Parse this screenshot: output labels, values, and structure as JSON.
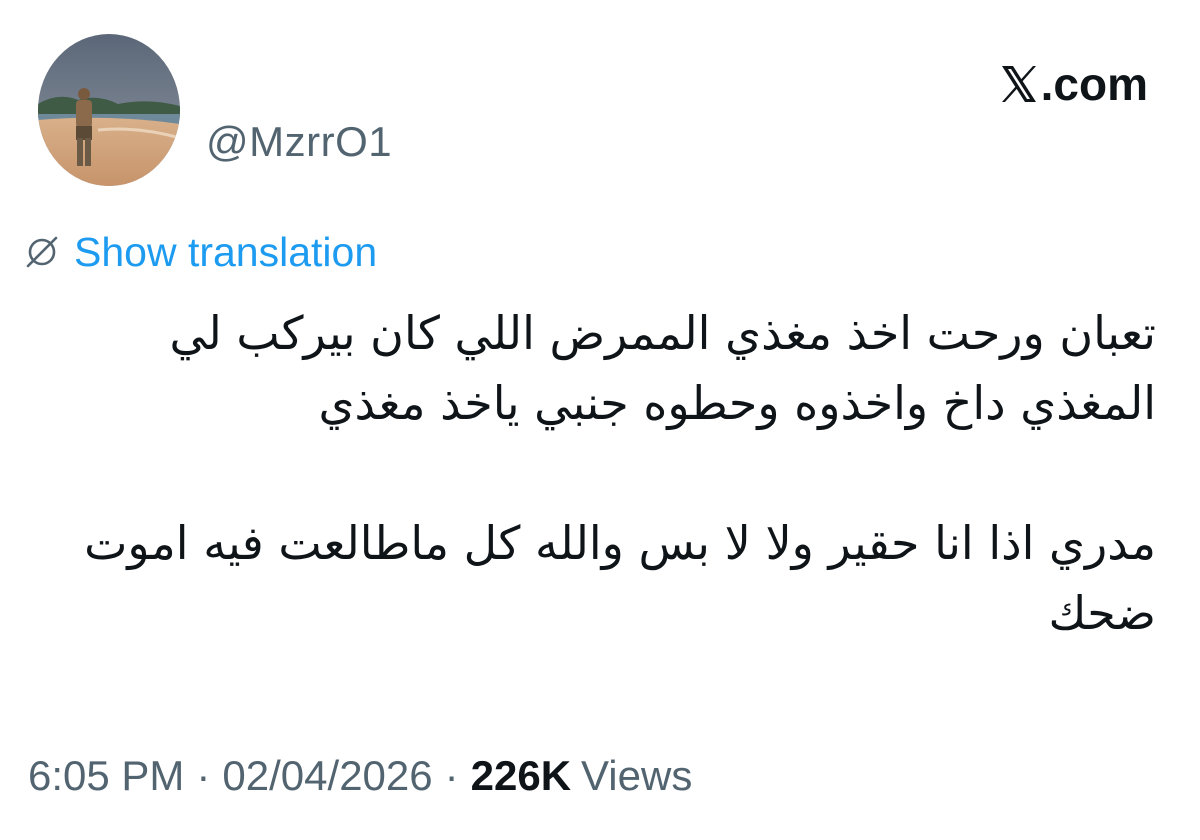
{
  "author": {
    "handle": "@MzrrO1",
    "avatar_icon": "beach-photo-avatar"
  },
  "brand": {
    "logo_icon": "x-logo-icon",
    "label": ".com"
  },
  "translation": {
    "icon": "globe-slash-icon",
    "label": "Show translation"
  },
  "tweet": {
    "paragraphs": [
      "تعبان ورحت اخذ مغذي الممرض اللي كان بيركب لي المغذي داخ واخذوه وحطوه جنبي ياخذ مغذي",
      "مدري اذا انا حقير ولا لا بس والله كل ماطالعت فيه اموت ضحك"
    ]
  },
  "meta": {
    "time": "6:05 PM",
    "separator": "·",
    "date": "02/04/2026",
    "views_count": "226K",
    "views_label": "Views"
  },
  "colors": {
    "link": "#1d9bf0",
    "secondary_text": "#536471",
    "primary_text": "#0f1419"
  }
}
